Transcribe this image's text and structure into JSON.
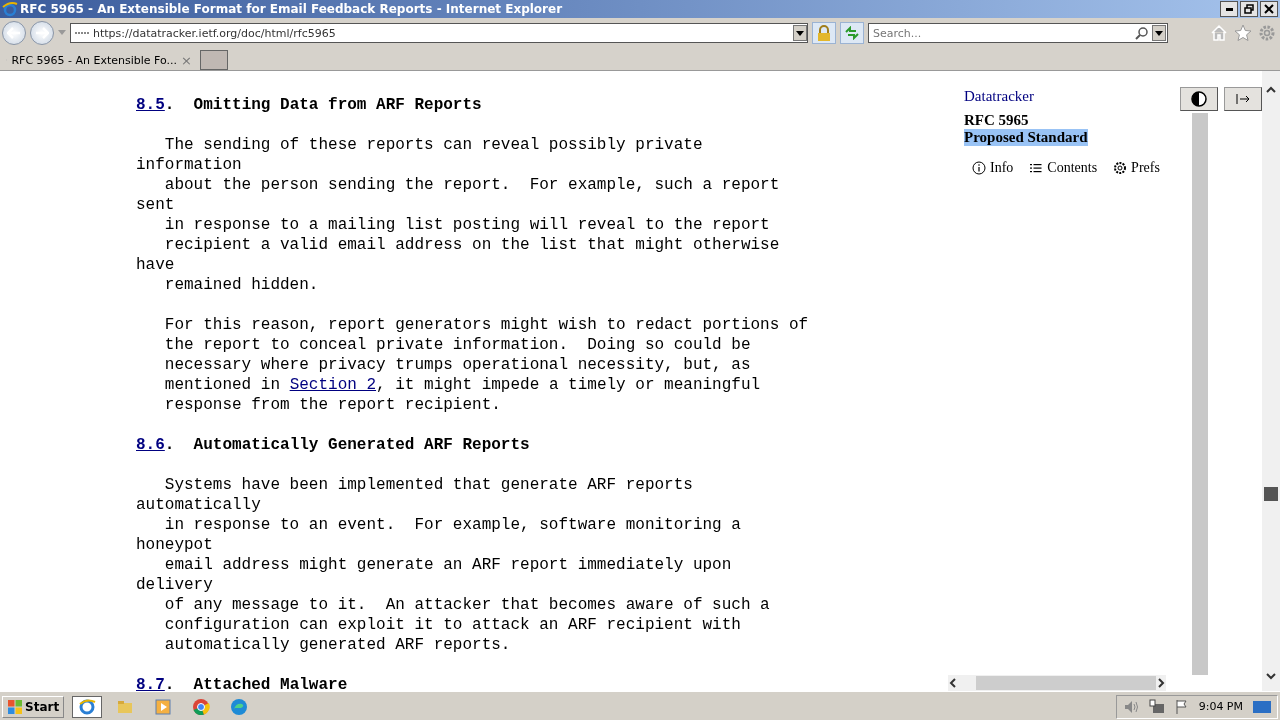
{
  "window": {
    "title": "RFC 5965 - An Extensible Format for Email Feedback Reports - Internet Explorer"
  },
  "address_bar": {
    "url": "https://datatracker.ietf.org/doc/html/rfc5965"
  },
  "search": {
    "placeholder": "Search..."
  },
  "tabs": [
    {
      "label": "RFC 5965 - An Extensible Fo...",
      "selected": true,
      "close": "×"
    }
  ],
  "document": {
    "sections": [
      {
        "number": "8.5",
        "title": ".  Omitting Data from ARF Reports",
        "paragraphs": [
          [
            {
              "text": "The sending of these reports can reveal possibly private",
              "indent": true
            },
            {
              "text": "information",
              "indent": false
            },
            {
              "text": "about the person sending the report.  For example, such a report",
              "indent": true
            },
            {
              "text": "sent",
              "indent": false
            },
            {
              "text": "in response to a mailing list posting will reveal to the report",
              "indent": true
            },
            {
              "text": "recipient a valid email address on the list that might otherwise",
              "indent": true
            },
            {
              "text": "have",
              "indent": false
            },
            {
              "text": "remained hidden.",
              "indent": true
            }
          ],
          [
            {
              "text": "For this reason, report generators might wish to redact portions of",
              "indent": true
            },
            {
              "text": "the report to conceal private information.  Doing so could be",
              "indent": true
            },
            {
              "text": "necessary where privacy trumps operational necessity, but, as",
              "indent": true
            },
            {
              "text": "mentioned in ",
              "link": "Section 2",
              "after": ", it might impede a timely or meaningful",
              "indent": true
            },
            {
              "text": "response from the report recipient.",
              "indent": true
            }
          ]
        ]
      },
      {
        "number": "8.6",
        "title": ".  Automatically Generated ARF Reports",
        "paragraphs": [
          [
            {
              "text": "Systems have been implemented that generate ARF reports",
              "indent": true
            },
            {
              "text": "automatically",
              "indent": false
            },
            {
              "text": "in response to an event.  For example, software monitoring a",
              "indent": true
            },
            {
              "text": "honeypot",
              "indent": false
            },
            {
              "text": "email address might generate an ARF report immediately upon",
              "indent": true
            },
            {
              "text": "delivery",
              "indent": false
            },
            {
              "text": "of any message to it.  An attacker that becomes aware of such a",
              "indent": true
            },
            {
              "text": "configuration can exploit it to attack an ARF recipient with",
              "indent": true
            },
            {
              "text": "automatically generated ARF reports.",
              "indent": true
            }
          ]
        ]
      },
      {
        "number": "8.7",
        "title": ".  Attached Malware"
      }
    ]
  },
  "sidebar": {
    "link": "Datatracker",
    "rfc": "RFC 5965",
    "status": "Proposed Standard",
    "status_selected": true,
    "nav": [
      {
        "kind": "info",
        "label": "Info"
      },
      {
        "kind": "contents",
        "label": "Contents"
      },
      {
        "kind": "prefs",
        "label": "Prefs"
      }
    ]
  },
  "taskbar": {
    "start": "Start",
    "apps": [
      {
        "kind": "ie",
        "selected": true
      },
      {
        "kind": "folder",
        "selected": false
      },
      {
        "kind": "media",
        "selected": false
      },
      {
        "kind": "chrome",
        "selected": false
      },
      {
        "kind": "edge",
        "selected": false
      }
    ],
    "time": "9:04 PM"
  }
}
